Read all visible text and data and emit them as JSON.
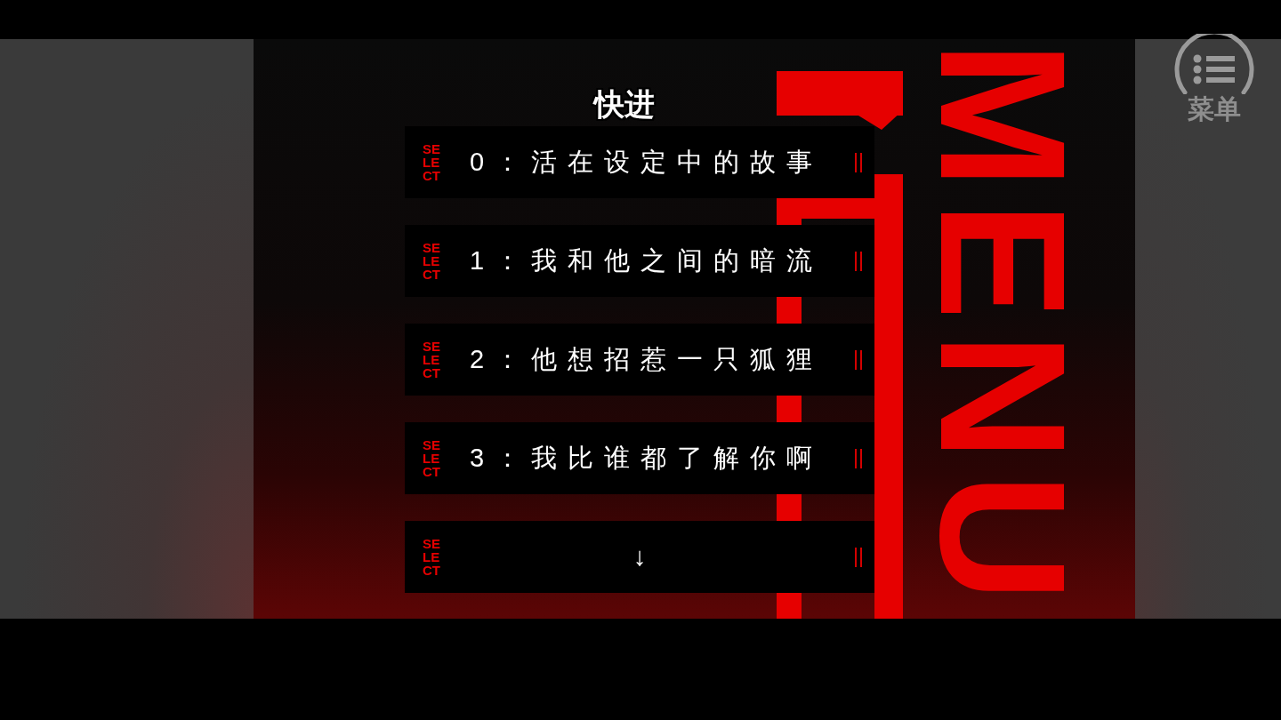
{
  "status_caption": "快进",
  "menu_button": {
    "label": "菜单"
  },
  "title_art": "MENU",
  "choices": [
    {
      "kind": "choice",
      "badge": "SELECT",
      "label": "0：活在设定中的故事"
    },
    {
      "kind": "choice",
      "badge": "SELECT",
      "label": "1：我和他之间的暗流"
    },
    {
      "kind": "choice",
      "badge": "SELECT",
      "label": "2：他想招惹一只狐狸"
    },
    {
      "kind": "choice",
      "badge": "SELECT",
      "label": "3：我比谁都了解你啊"
    },
    {
      "kind": "more",
      "badge": "SELECT",
      "label": "↓"
    }
  ]
}
